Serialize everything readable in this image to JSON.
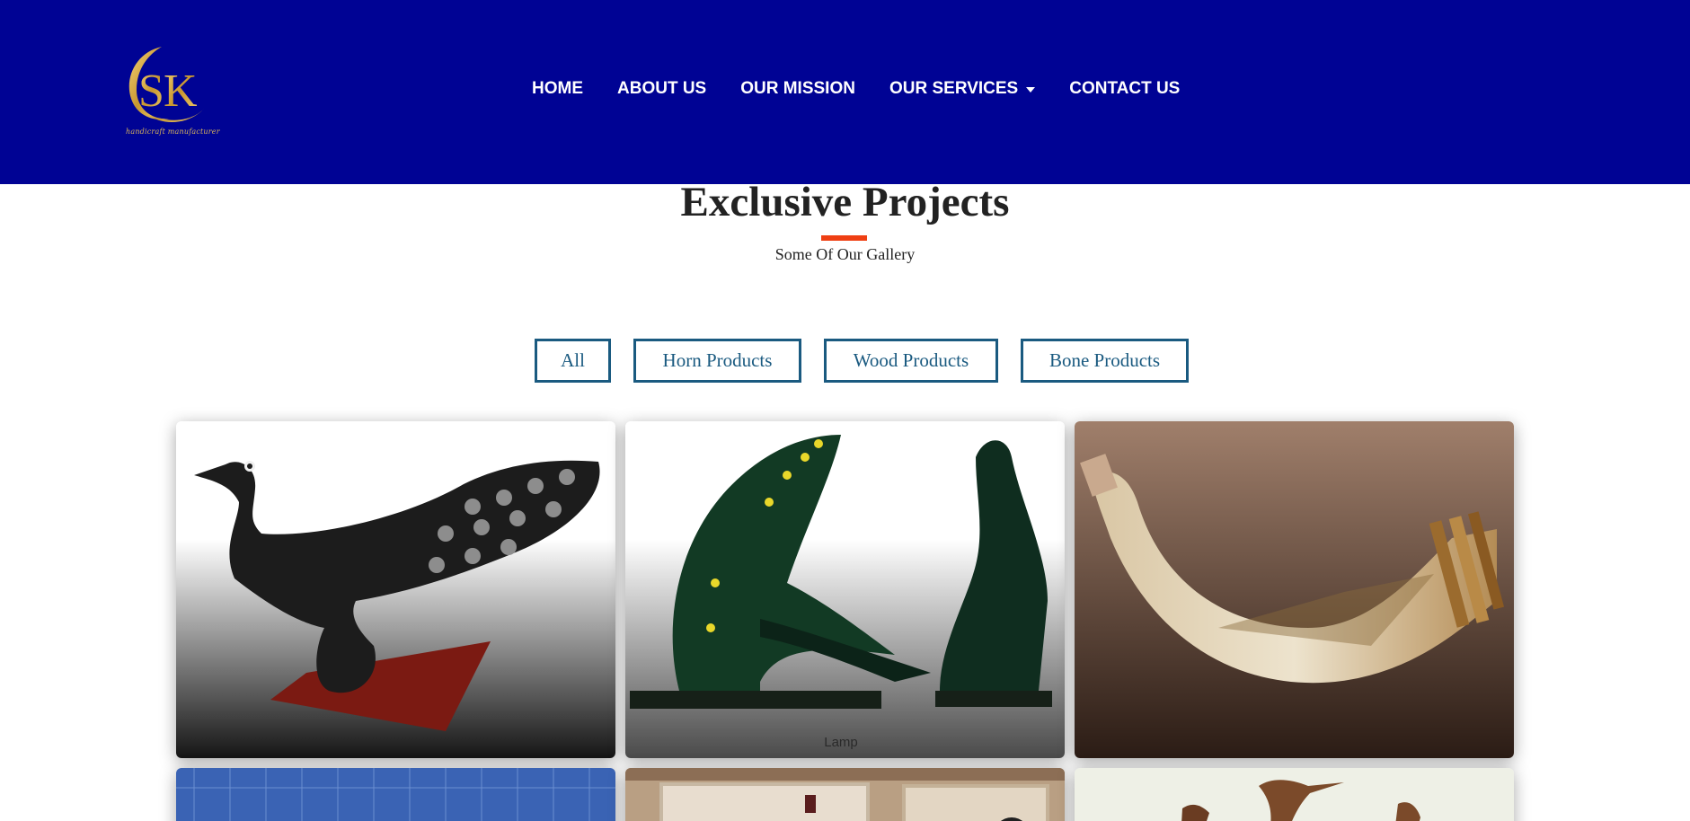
{
  "header": {
    "logo": {
      "text": "SK",
      "tagline": "handicraft manufacturer"
    },
    "nav": [
      {
        "label": "HOME"
      },
      {
        "label": "ABOUT US"
      },
      {
        "label": "OUR MISSION"
      },
      {
        "label": "OUR SERVICES",
        "has_dropdown": true
      },
      {
        "label": "CONTACT US"
      }
    ],
    "background_color": "#000394"
  },
  "section": {
    "title": "Exclusive Projects",
    "subtitle": "Some Of Our Gallery",
    "accent_color": "#ef3f13"
  },
  "filters": [
    {
      "label": "All"
    },
    {
      "label": "Horn Products"
    },
    {
      "label": "Wood Products"
    },
    {
      "label": "Bone Products"
    }
  ],
  "gallery": {
    "items": [
      {
        "subject": "carved-horn-peacock"
      },
      {
        "subject": "horn-bird-lamp",
        "caption": "Lamp"
      },
      {
        "subject": "carved-bone-horn-on-carpet"
      },
      {
        "subject": "blue-grid-image"
      },
      {
        "subject": "wood-workshop"
      },
      {
        "subject": "horn-heron-figurines"
      }
    ]
  }
}
